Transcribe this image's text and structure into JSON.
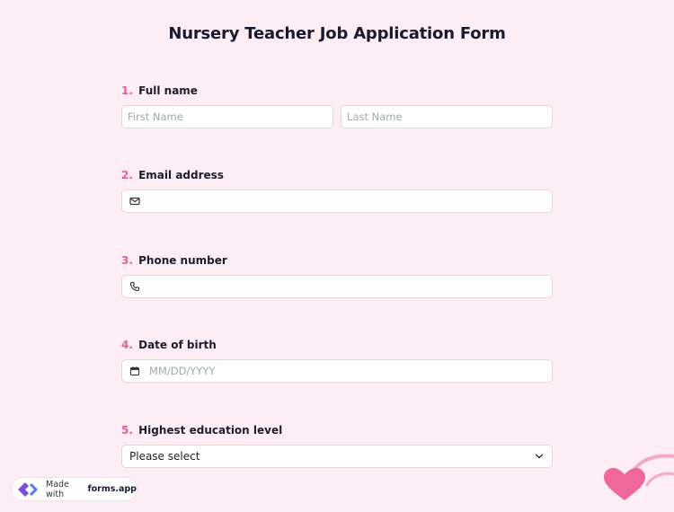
{
  "form": {
    "title": "Nursery Teacher Job Application Form"
  },
  "questions": [
    {
      "number": "1.",
      "label": "Full name",
      "fields": [
        {
          "placeholder": "First Name"
        },
        {
          "placeholder": "Last Name"
        }
      ]
    },
    {
      "number": "2.",
      "label": "Email address",
      "icon": "envelope-icon",
      "value": ""
    },
    {
      "number": "3.",
      "label": "Phone number",
      "icon": "phone-icon",
      "value": ""
    },
    {
      "number": "4.",
      "label": "Date of birth",
      "icon": "calendar-icon",
      "placeholder": "MM/DD/YYYY"
    },
    {
      "number": "5.",
      "label": "Highest education level",
      "selected": "Please select",
      "icon": "chevron-down-icon"
    }
  ],
  "badge": {
    "prefix": "Made with",
    "brand": "forms.app"
  },
  "colors": {
    "background": "#fdeef6",
    "accent": "#e75b9d",
    "heart": "#f0679e"
  }
}
